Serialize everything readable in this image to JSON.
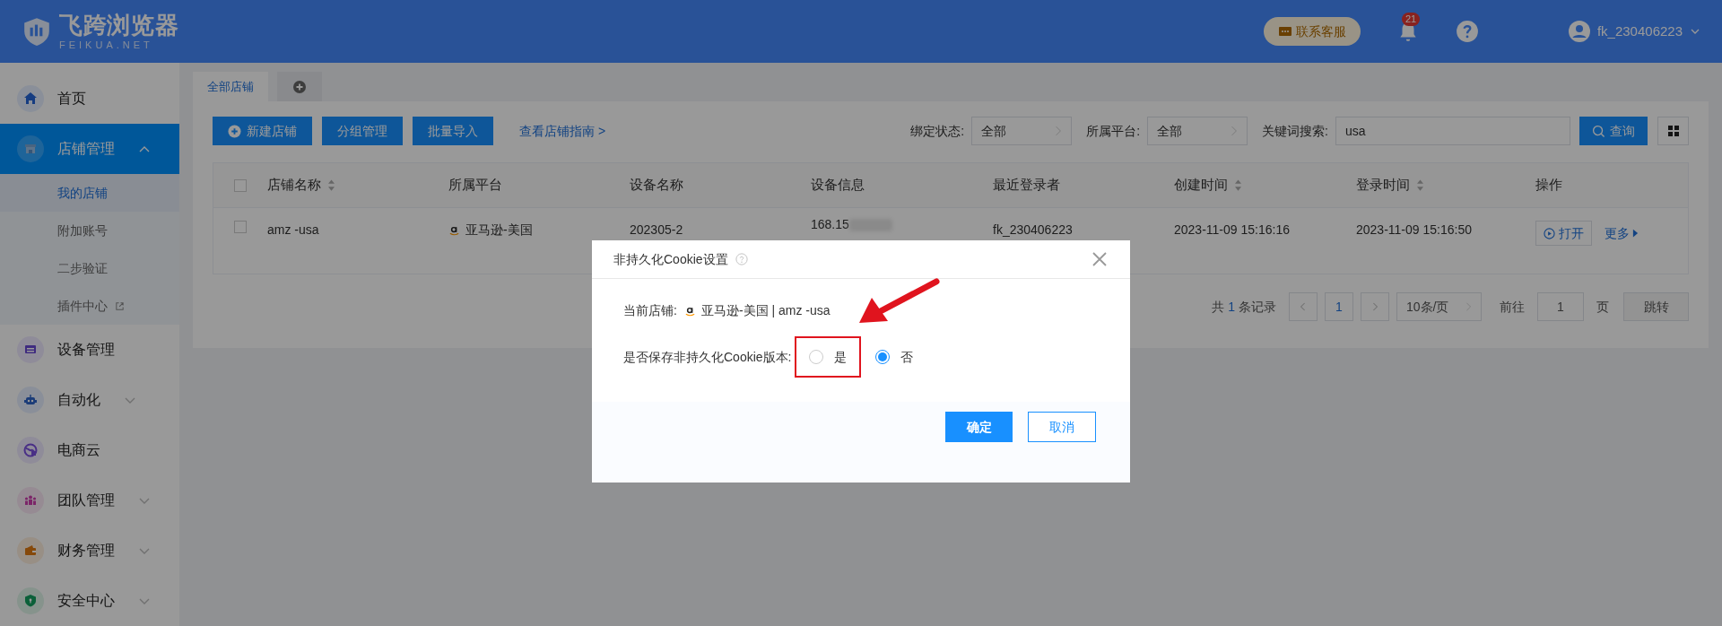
{
  "header": {
    "logo_title": "飞跨浏览器",
    "logo_subtitle": "FEIKUA.NET",
    "support_button": "联系客服",
    "notification_count": "21",
    "username": "fk_230406223"
  },
  "sidebar": {
    "items": [
      {
        "label": "首页",
        "kind": "link",
        "selected": false
      },
      {
        "label": "店铺管理",
        "kind": "group",
        "selected": true,
        "expanded": true,
        "children": [
          {
            "label": "我的店铺",
            "selected": true,
            "external": false
          },
          {
            "label": "附加账号",
            "selected": false,
            "external": false
          },
          {
            "label": "二步验证",
            "selected": false,
            "external": false
          },
          {
            "label": "插件中心",
            "selected": false,
            "external": true
          }
        ]
      },
      {
        "label": "设备管理",
        "kind": "link",
        "selected": false
      },
      {
        "label": "自动化",
        "kind": "group",
        "selected": false,
        "expanded": false
      },
      {
        "label": "电商云",
        "kind": "link",
        "selected": false
      },
      {
        "label": "团队管理",
        "kind": "group",
        "selected": false,
        "expanded": false
      },
      {
        "label": "财务管理",
        "kind": "group",
        "selected": false,
        "expanded": false
      },
      {
        "label": "安全中心",
        "kind": "group",
        "selected": false,
        "expanded": false
      }
    ]
  },
  "tabs": [
    {
      "label": "全部店铺",
      "kind": "text",
      "selected": true
    },
    {
      "kind": "add",
      "selected": false
    }
  ],
  "toolbar": {
    "buttons": [
      {
        "label": "新建店铺",
        "kind": "add"
      },
      {
        "label": "分组管理",
        "kind": "plain"
      },
      {
        "label": "批量导入",
        "kind": "plain"
      }
    ],
    "guide_link": "查看店铺指南 >"
  },
  "filters": [
    {
      "label": "绑定状态:",
      "value": "全部",
      "kind": "select"
    },
    {
      "label": "所属平台:",
      "value": "全部",
      "kind": "select"
    },
    {
      "label": "关键词搜索:",
      "value": "usa",
      "kind": "input"
    }
  ],
  "search_button": "查询",
  "table": {
    "columns": [
      {
        "label": "店铺名称",
        "sortable": true
      },
      {
        "label": "所属平台",
        "sortable": false
      },
      {
        "label": "设备名称",
        "sortable": false
      },
      {
        "label": "设备信息",
        "sortable": false
      },
      {
        "label": "最近登录者",
        "sortable": false
      },
      {
        "label": "创建时间",
        "sortable": true
      },
      {
        "label": "登录时间",
        "sortable": true
      },
      {
        "label": "操作",
        "sortable": false
      }
    ],
    "header_checked": false,
    "rows": [
      {
        "checked": false,
        "store": "amz -usa",
        "platform": "亚马逊-美国",
        "device": "202305-2",
        "device_info": "168.15",
        "last_login": "fk_230406223",
        "created": "2023-11-09 15:16:16",
        "login_time": "2023-11-09 15:16:50",
        "open": "打开",
        "more": "更多"
      }
    ]
  },
  "pagination": {
    "total_prefix": "共",
    "total": "1",
    "total_suffix": "条记录",
    "page": "1",
    "page_size": "10条/页",
    "goto_label": "前往",
    "goto_value": "1",
    "goto_suffix": "页",
    "jump": "跳转"
  },
  "dialog": {
    "title": "非持久化Cookie设置",
    "store_label": "当前店铺:",
    "store_value": "亚马逊-美国 | amz -usa",
    "question": "是否保存非持久化Cookie版本:",
    "options": [
      {
        "label": "是",
        "selected": false,
        "highlighted": true
      },
      {
        "label": "否",
        "selected": true,
        "highlighted": false
      }
    ],
    "confirm": "确定",
    "cancel": "取消"
  }
}
